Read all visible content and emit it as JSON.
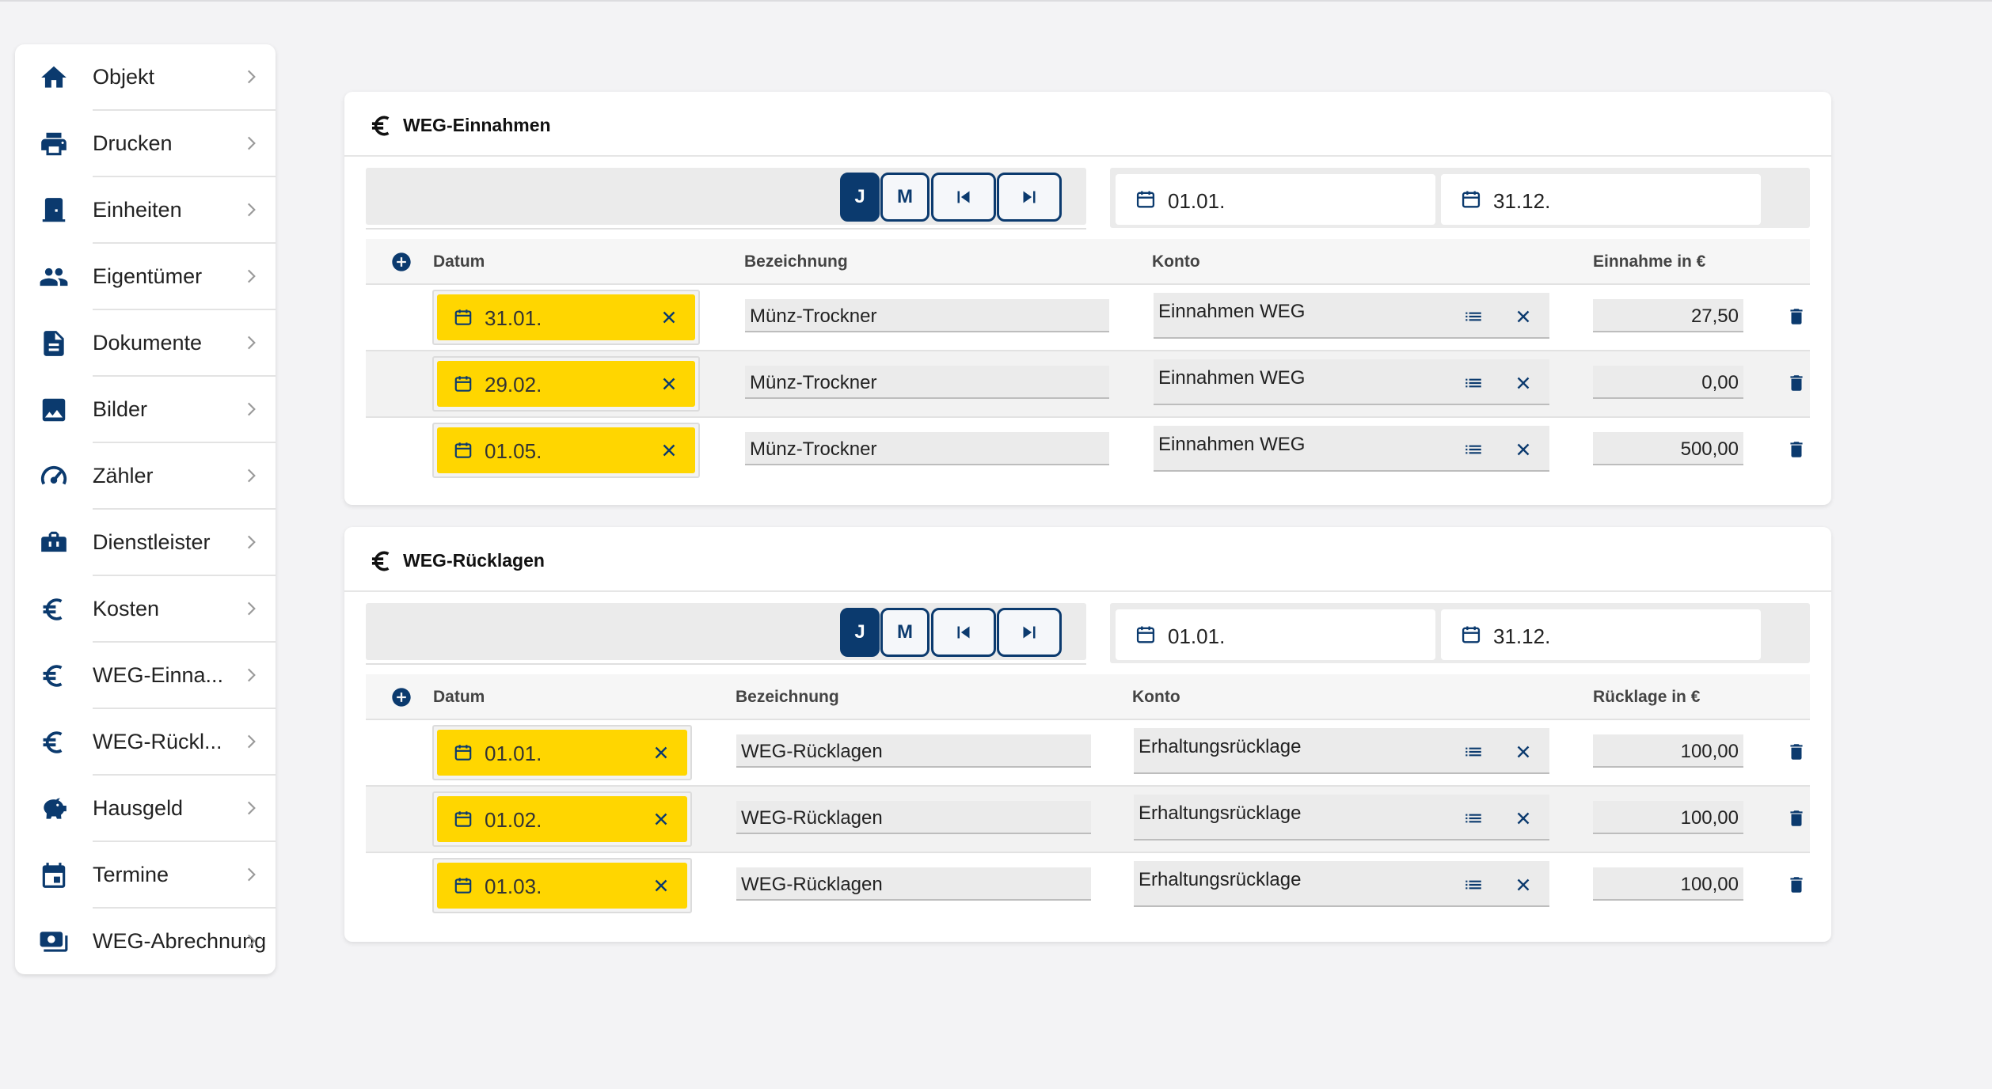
{
  "colors": {
    "accent": "#0b3a6e",
    "date_highlight": "#ffd600",
    "background": "#f3f3f5"
  },
  "sidebar": {
    "items": [
      {
        "label": "Objekt",
        "icon": "home-icon"
      },
      {
        "label": "Drucken",
        "icon": "printer-icon"
      },
      {
        "label": "Einheiten",
        "icon": "door-icon"
      },
      {
        "label": "Eigentümer",
        "icon": "people-icon"
      },
      {
        "label": "Dokumente",
        "icon": "document-icon"
      },
      {
        "label": "Bilder",
        "icon": "image-icon"
      },
      {
        "label": "Zähler",
        "icon": "speedometer-icon"
      },
      {
        "label": "Dienstleister",
        "icon": "toolbox-icon"
      },
      {
        "label": "Kosten",
        "icon": "euro-icon"
      },
      {
        "label": "WEG-Einna...",
        "icon": "euro-icon"
      },
      {
        "label": "WEG-Rückl...",
        "icon": "euro-icon"
      },
      {
        "label": "Hausgeld",
        "icon": "piggy-bank-icon"
      },
      {
        "label": "Termine",
        "icon": "calendar-icon"
      },
      {
        "label": "WEG-Abrechnung",
        "icon": "money-icon"
      }
    ]
  },
  "einnahmen": {
    "title": "WEG-Einnahmen",
    "buttons": {
      "year": "J",
      "month": "M"
    },
    "date_from": "01.01.",
    "date_to": "31.12.",
    "columns": {
      "datum": "Datum",
      "bezeichnung": "Bezeichnung",
      "konto": "Konto",
      "betrag": "Einnahme in €"
    },
    "rows": [
      {
        "datum": "31.01.",
        "bezeichnung": "Münz-Trockner",
        "konto": "Einnahmen WEG",
        "betrag": "27,50"
      },
      {
        "datum": "29.02.",
        "bezeichnung": "Münz-Trockner",
        "konto": "Einnahmen WEG",
        "betrag": "0,00"
      },
      {
        "datum": "01.05.",
        "bezeichnung": "Münz-Trockner",
        "konto": "Einnahmen WEG",
        "betrag": "500,00"
      }
    ]
  },
  "ruecklagen": {
    "title": "WEG-Rücklagen",
    "buttons": {
      "year": "J",
      "month": "M"
    },
    "date_from": "01.01.",
    "date_to": "31.12.",
    "columns": {
      "datum": "Datum",
      "bezeichnung": "Bezeichnung",
      "konto": "Konto",
      "betrag": "Rücklage in €"
    },
    "rows": [
      {
        "datum": "01.01.",
        "bezeichnung": "WEG-Rücklagen",
        "konto": "Erhaltungsrücklage",
        "betrag": "100,00"
      },
      {
        "datum": "01.02.",
        "bezeichnung": "WEG-Rücklagen",
        "konto": "Erhaltungsrücklage",
        "betrag": "100,00"
      },
      {
        "datum": "01.03.",
        "bezeichnung": "WEG-Rücklagen",
        "konto": "Erhaltungsrücklage",
        "betrag": "100,00"
      }
    ]
  }
}
